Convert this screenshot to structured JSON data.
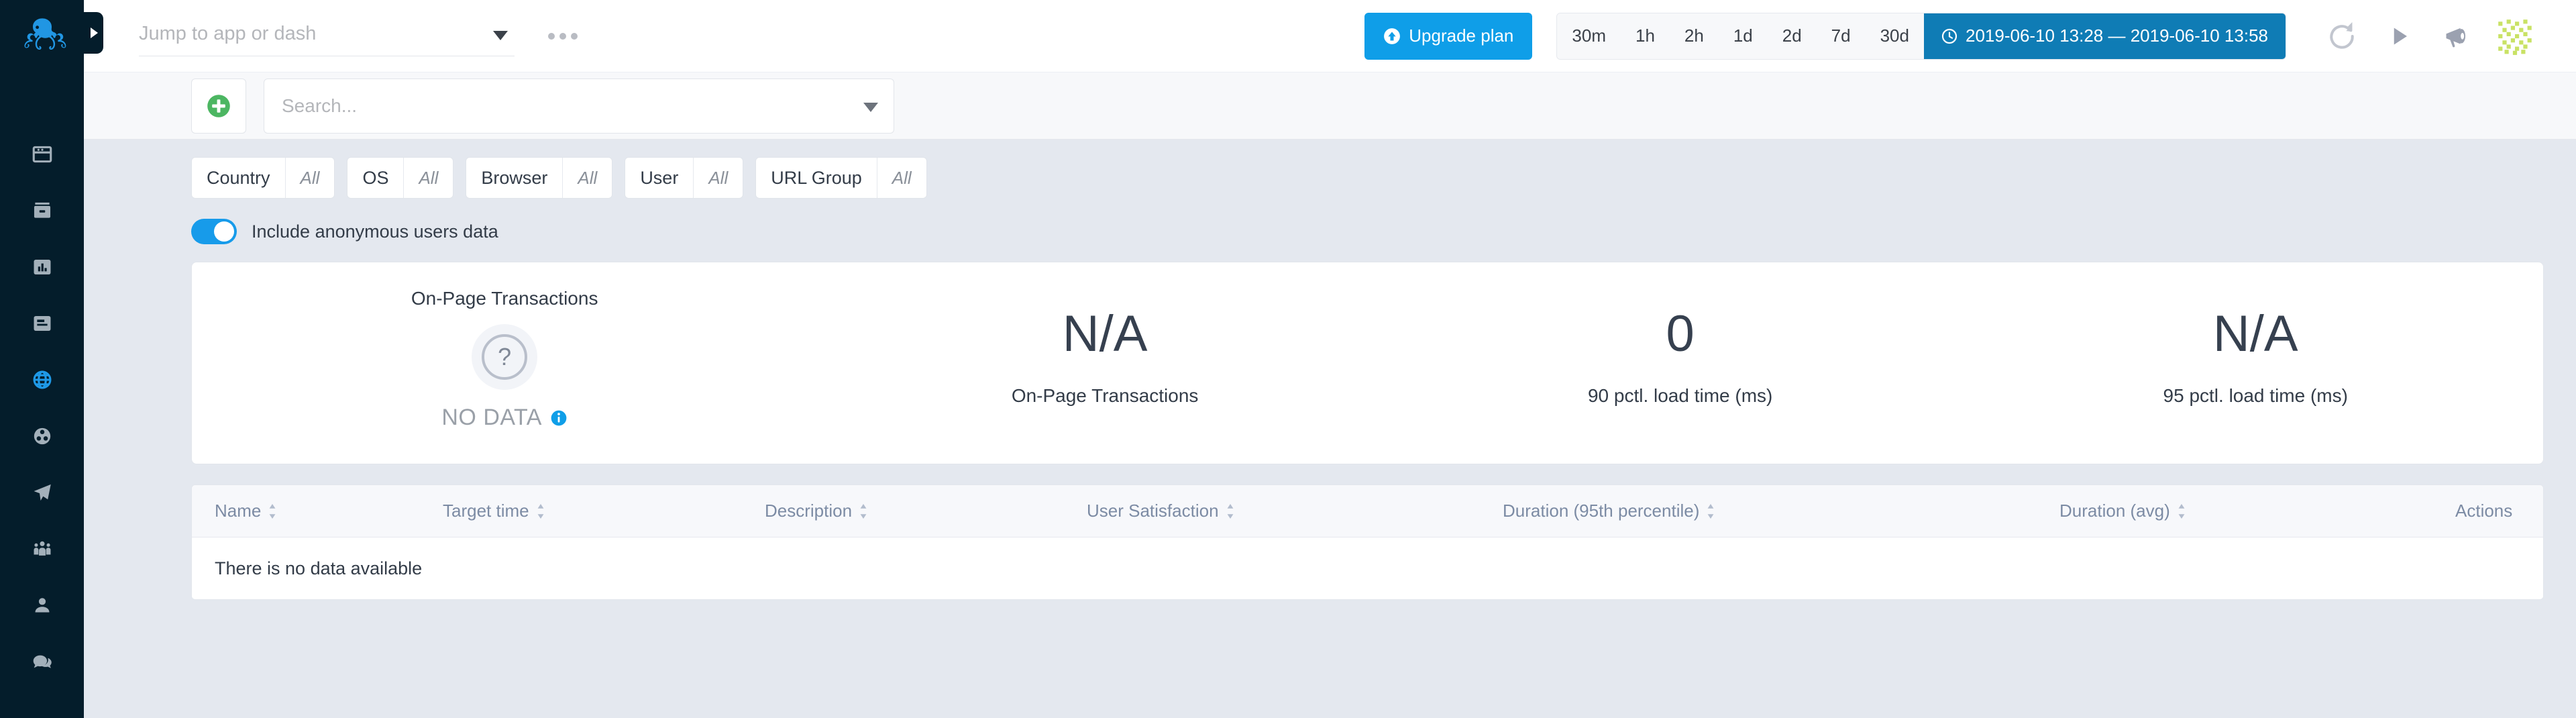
{
  "sidebar": {
    "logo_name": "octopus-logo",
    "toggle_label": "",
    "items": [
      {
        "name": "sidebar-item-apps",
        "icon": "browser-window-icon",
        "active": false
      },
      {
        "name": "sidebar-item-archive",
        "icon": "archive-box-icon",
        "active": false
      },
      {
        "name": "sidebar-item-metrics",
        "icon": "bar-chart-icon",
        "active": false
      },
      {
        "name": "sidebar-item-logs",
        "icon": "logs-document-icon",
        "active": false
      },
      {
        "name": "sidebar-item-experience",
        "icon": "globe-icon",
        "active": true
      },
      {
        "name": "sidebar-item-tracing",
        "icon": "three-circles-icon",
        "active": false
      },
      {
        "name": "sidebar-item-synthetics",
        "icon": "paper-plane-icon",
        "active": false
      },
      {
        "name": "sidebar-item-teams",
        "icon": "people-group-icon",
        "active": false
      },
      {
        "name": "sidebar-item-account",
        "icon": "user-icon",
        "active": false
      },
      {
        "name": "sidebar-item-chat",
        "icon": "chat-bubbles-icon",
        "active": false
      }
    ]
  },
  "topbar": {
    "jump": {
      "value": "",
      "placeholder": "Jump to app or dash"
    },
    "more_menu_label": "...",
    "upgrade_label": "Upgrade plan",
    "time_options": [
      "30m",
      "1h",
      "2h",
      "1d",
      "2d",
      "7d",
      "30d"
    ],
    "time_range_label": "2019-06-10 13:28 — 2019-06-10 13:58",
    "actions": [
      {
        "name": "refresh-icon"
      },
      {
        "name": "play-icon"
      },
      {
        "name": "megaphone-icon"
      }
    ],
    "avatar_name": "user-avatar"
  },
  "search_row": {
    "add_label": "+",
    "search": {
      "value": "",
      "placeholder": "Search..."
    }
  },
  "filters": {
    "chips": [
      {
        "key": "Country",
        "value": "All"
      },
      {
        "key": "OS",
        "value": "All"
      },
      {
        "key": "Browser",
        "value": "All"
      },
      {
        "key": "User",
        "value": "All"
      },
      {
        "key": "URL Group",
        "value": "All"
      }
    ],
    "toggle": {
      "label": "Include anonymous users data",
      "on": true
    }
  },
  "stats": {
    "panel_title": "On-Page Transactions",
    "no_data_text": "NO DATA",
    "question_mark": "?",
    "cells": [
      {
        "value": "N/A",
        "label": "On-Page Transactions"
      },
      {
        "value": "0",
        "label": "90 pctl. load time (ms)"
      },
      {
        "value": "N/A",
        "label": "95 pctl. load time (ms)"
      }
    ]
  },
  "table": {
    "columns": [
      {
        "label": "Name",
        "sortable": true
      },
      {
        "label": "Target time",
        "sortable": true
      },
      {
        "label": "Description",
        "sortable": true
      },
      {
        "label": "User Satisfaction",
        "sortable": true
      },
      {
        "label": "Duration (95th percentile)",
        "sortable": true
      },
      {
        "label": "Duration (avg)",
        "sortable": true
      },
      {
        "label": "Actions",
        "sortable": false
      }
    ],
    "rows": [],
    "empty_message": "There is no data available"
  },
  "colors": {
    "sidebar_bg": "#041d2b",
    "accent_blue": "#0f9ee8",
    "time_active": "#0f7cb5",
    "page_bg": "#e4e8ef",
    "add_green": "#4cb662",
    "avatar_green": "#c9e265"
  }
}
